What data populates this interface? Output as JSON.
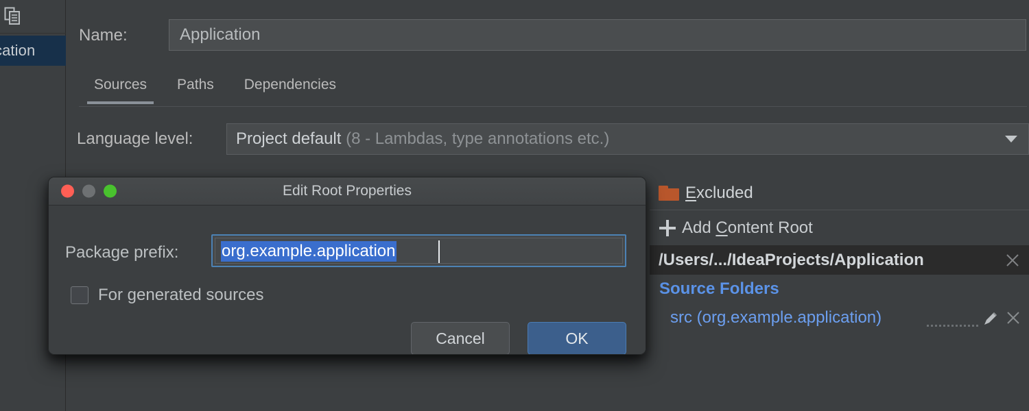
{
  "sidebar": {
    "toolbar_icon": "copy-module-icon",
    "selected_item_label": "cation"
  },
  "main": {
    "name_label": "Name:",
    "name_value": "Application",
    "tabs": [
      {
        "label": "Sources",
        "active": true
      },
      {
        "label": "Paths",
        "active": false
      },
      {
        "label": "Dependencies",
        "active": false
      }
    ],
    "language_level_label": "Language level:",
    "language_level_primary": "Project default",
    "language_level_secondary": "(8 - Lambdas, type annotations etc.)",
    "dropdown_icon": "chevron-down-icon"
  },
  "right_panel": {
    "excluded_label_prefix": "",
    "excluded_mnemonic": "E",
    "excluded_label_rest": "xcluded",
    "folder_icon": "folder-icon",
    "folder_color": "#b9572c",
    "add_content_root_prefix": "Add ",
    "add_content_root_mnemonic": "C",
    "add_content_root_rest": "ontent Root",
    "plus_icon": "plus-icon",
    "content_root_path": "/Users/.../IdeaProjects/Application",
    "content_root_close_icon": "close-icon",
    "source_folders_title": "Source Folders",
    "source_folder_entry": "src (org.example.application)",
    "source_folder_edit_icon": "pencil-icon",
    "source_folder_close_icon": "close-icon",
    "link_color": "#6c9ff0"
  },
  "dialog": {
    "title": "Edit Root Properties",
    "traffic_lights": {
      "close": "close-window-button",
      "minimize": "minimize-window-button",
      "maximize": "maximize-window-button",
      "close_color": "#ff5f55",
      "minimize_color": "#6e7173",
      "maximize_color": "#49c22e"
    },
    "package_prefix_label": "Package prefix:",
    "package_prefix_value": "org.example.application",
    "package_prefix_selected": true,
    "checkbox_label": "For generated sources",
    "checkbox_checked": false,
    "cancel_label": "Cancel",
    "ok_label": "OK",
    "selection_color": "#3a6ecd",
    "focus_border_color": "#4c82b5",
    "ok_button_color": "#3c5f8c"
  }
}
